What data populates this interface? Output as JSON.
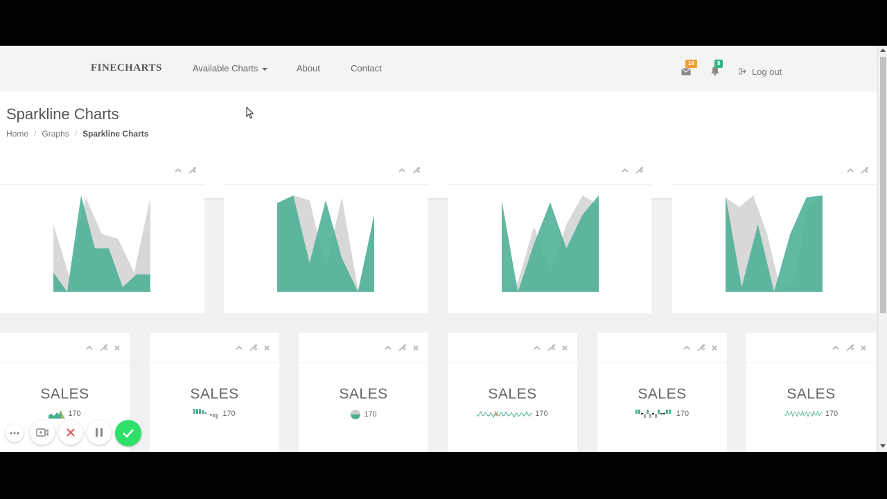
{
  "navbar": {
    "brand": "FINECHARTS",
    "links": [
      {
        "label": "Available Charts"
      },
      {
        "label": "About"
      },
      {
        "label": "Contact"
      }
    ],
    "messages_badge": "16",
    "notifications_badge": "8",
    "logout_label": "Log out"
  },
  "header": {
    "title": "Sparkline Charts",
    "breadcrumb": [
      "Home",
      "Graphs",
      "Sparkline Charts"
    ]
  },
  "colors": {
    "accent": "#4caf94",
    "grey_area": "#d8d8d8",
    "messages_badge": "#f0a030",
    "notifications_badge": "#34b380",
    "record_confirm": "#2ee06a",
    "record_cancel": "#e05555"
  },
  "big_charts": [
    {
      "grey": [
        0.7,
        0.15,
        0.98,
        0.6,
        0.55,
        0.2,
        0.98
      ],
      "green": [
        0.2,
        0.0,
        1.0,
        0.45,
        0.45,
        0.05,
        0.18,
        0.18
      ]
    },
    {
      "grey": [
        0.92,
        1.0,
        0.95,
        0.25,
        0.98,
        0.02,
        0.8
      ],
      "green": [
        0.92,
        1.0,
        0.3,
        0.95,
        0.35,
        0.0,
        0.8
      ]
    },
    {
      "grey": [
        0.0,
        0.1,
        0.68,
        0.18,
        0.7,
        1.0,
        0.9
      ],
      "green": [
        0.95,
        0.0,
        0.5,
        0.93,
        0.45,
        0.8,
        1.0
      ]
    },
    {
      "grey": [
        0.98,
        0.88,
        1.0,
        0.6,
        0.0,
        0.1,
        0.92,
        1.0
      ],
      "green": [
        1.0,
        0.05,
        0.7,
        0.0,
        0.6,
        0.98,
        1.0
      ]
    }
  ],
  "small_panels": [
    {
      "label": "SALES",
      "value": "170",
      "spark": "area"
    },
    {
      "label": "SALES",
      "value": "170",
      "spark": "bar"
    },
    {
      "label": "SALES",
      "value": "170",
      "spark": "pie"
    },
    {
      "label": "SALES",
      "value": "170",
      "spark": "line"
    },
    {
      "label": "SALES",
      "value": "170",
      "spark": "tristate"
    },
    {
      "label": "SALES",
      "value": "170",
      "spark": "thinline"
    }
  ]
}
